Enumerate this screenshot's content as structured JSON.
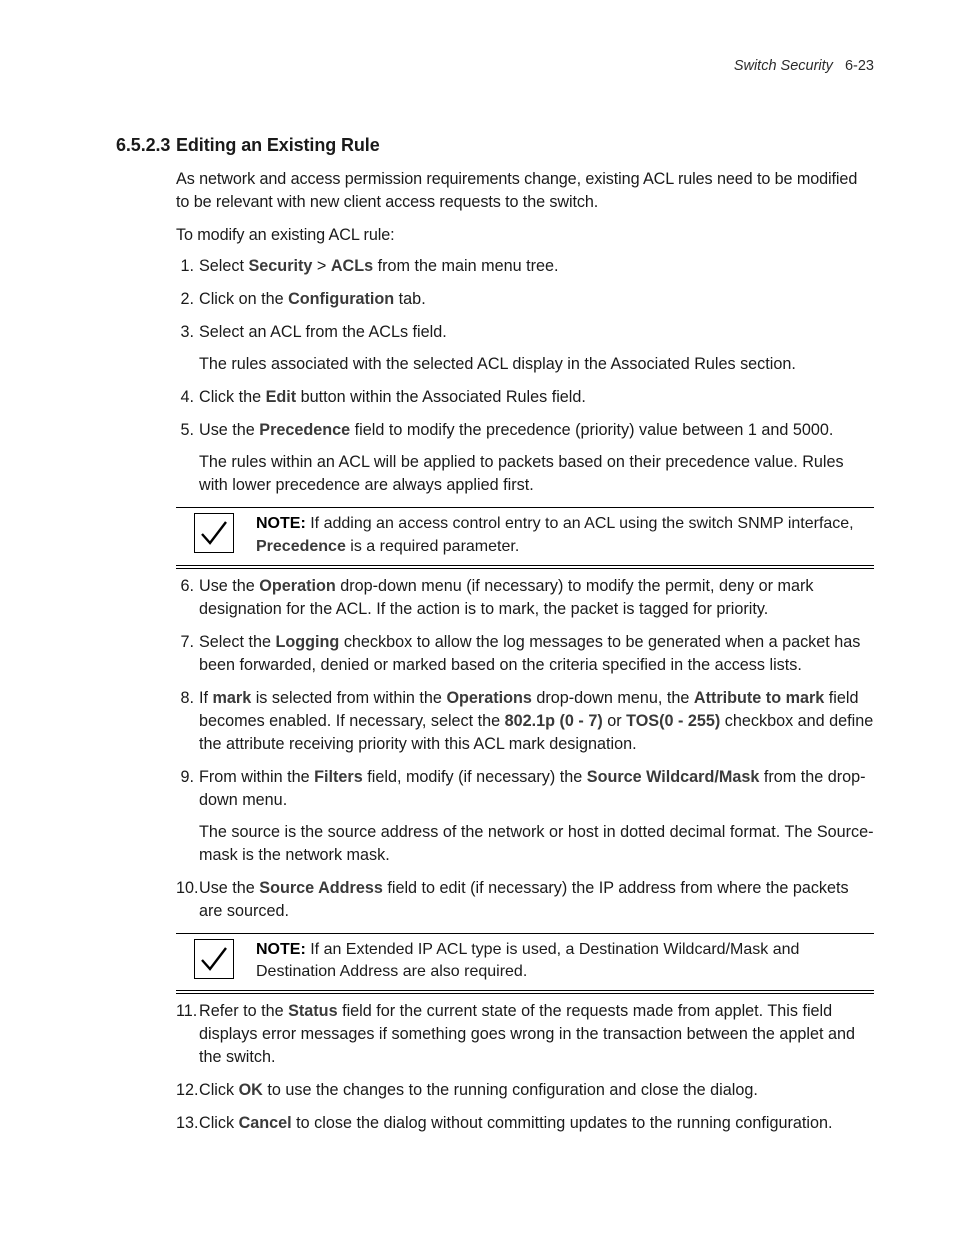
{
  "header": {
    "chapter": "Switch Security",
    "page_number": "6-23"
  },
  "section": {
    "number": "6.5.2.3",
    "title": "Editing an Existing Rule"
  },
  "intro": {
    "p1": "As network and access permission requirements change, existing ACL rules need to be modified to be relevant with new client access requests to the switch.",
    "p2": "To modify an existing ACL rule:"
  },
  "steps": [
    {
      "num": "1.",
      "parts": [
        {
          "t": "Select ",
          "b": false
        },
        {
          "t": "Security",
          "b": true
        },
        {
          "t": " > ",
          "b": false
        },
        {
          "t": "ACLs",
          "b": true
        },
        {
          "t": " from the main menu tree.",
          "b": false
        }
      ]
    },
    {
      "num": "2.",
      "parts": [
        {
          "t": "Click on the ",
          "b": false
        },
        {
          "t": "Configuration",
          "b": true
        },
        {
          "t": " tab.",
          "b": false
        }
      ]
    },
    {
      "num": "3.",
      "parts": [
        {
          "t": "Select an ACL from the ACLs field.",
          "b": false
        }
      ],
      "sub": [
        {
          "t": "The rules associated with the selected ACL display in the Associated Rules section.",
          "b": false
        }
      ]
    },
    {
      "num": "4.",
      "parts": [
        {
          "t": "Click the ",
          "b": false
        },
        {
          "t": "Edit",
          "b": true
        },
        {
          "t": " button within the Associated Rules field.",
          "b": false
        }
      ]
    },
    {
      "num": "5.",
      "parts": [
        {
          "t": "Use the ",
          "b": false
        },
        {
          "t": "Precedence",
          "b": true
        },
        {
          "t": " field to modify the precedence (priority) value between 1 and 5000.",
          "b": false
        }
      ],
      "sub": [
        {
          "t": "The rules within an ACL will be applied to packets based on their precedence value. Rules with lower precedence are always applied first.",
          "b": false
        }
      ]
    }
  ],
  "note1": {
    "label": "NOTE:",
    "parts": [
      {
        "t": " If adding an access control entry to an ACL using the switch SNMP interface, ",
        "b": false
      },
      {
        "t": "Precedence",
        "b": true
      },
      {
        "t": " is a required parameter.",
        "b": false
      }
    ]
  },
  "steps2": [
    {
      "num": "6.",
      "parts": [
        {
          "t": "Use the ",
          "b": false
        },
        {
          "t": "Operation",
          "b": true
        },
        {
          "t": " drop-down menu (if necessary) to modify the permit, deny or mark designation for the ACL. If the action is to mark, the packet is tagged for priority.",
          "b": false
        }
      ]
    },
    {
      "num": "7.",
      "parts": [
        {
          "t": "Select the ",
          "b": false
        },
        {
          "t": "Logging",
          "b": true
        },
        {
          "t": " checkbox to allow the log messages to be generated when a packet has been forwarded, denied or marked based on the criteria specified in the access lists.",
          "b": false
        }
      ]
    },
    {
      "num": "8.",
      "parts": [
        {
          "t": "If ",
          "b": false
        },
        {
          "t": "mark",
          "b": true
        },
        {
          "t": " is selected from within the ",
          "b": false
        },
        {
          "t": "Operations",
          "b": true
        },
        {
          "t": " drop-down menu, the ",
          "b": false
        },
        {
          "t": "Attribute to mark",
          "b": true
        },
        {
          "t": " field becomes enabled. If necessary, select the ",
          "b": false
        },
        {
          "t": "802.1p (0 - 7)",
          "b": true
        },
        {
          "t": " or ",
          "b": false
        },
        {
          "t": "TOS(0 - 255)",
          "b": true
        },
        {
          "t": " checkbox and define the attribute receiving priority with this ACL mark designation.",
          "b": false
        }
      ]
    },
    {
      "num": "9.",
      "parts": [
        {
          "t": "From within the ",
          "b": false
        },
        {
          "t": "Filters",
          "b": true
        },
        {
          "t": " field, modify (if necessary) the ",
          "b": false
        },
        {
          "t": "Source Wildcard/Mask",
          "b": true
        },
        {
          "t": " from the drop-down menu.",
          "b": false
        }
      ],
      "sub": [
        {
          "t": "The source is the source address of the network or host in dotted decimal format. The Source-mask is the network mask.",
          "b": false
        }
      ]
    },
    {
      "num": "10.",
      "parts": [
        {
          "t": "Use the ",
          "b": false
        },
        {
          "t": "Source Address",
          "b": true
        },
        {
          "t": " field to edit (if necessary) the IP address from where the packets are sourced.",
          "b": false
        }
      ]
    }
  ],
  "note2": {
    "label": "NOTE:",
    "parts": [
      {
        "t": " If an Extended IP ACL type is used, a Destination Wildcard/Mask and Destination Address are also required.",
        "b": false
      }
    ]
  },
  "steps3": [
    {
      "num": "11.",
      "parts": [
        {
          "t": "Refer to the ",
          "b": false
        },
        {
          "t": "Status",
          "b": true
        },
        {
          "t": " field for the current state of the requests made from applet. This field displays error messages if something goes wrong in the transaction between the applet and the switch.",
          "b": false
        }
      ]
    },
    {
      "num": "12.",
      "parts": [
        {
          "t": "Click ",
          "b": false
        },
        {
          "t": "OK",
          "b": true
        },
        {
          "t": " to use the changes to the running configuration and close the dialog.",
          "b": false
        }
      ]
    },
    {
      "num": "13.",
      "parts": [
        {
          "t": "Click ",
          "b": false
        },
        {
          "t": "Cancel",
          "b": true
        },
        {
          "t": " to close the dialog without committing updates to the running configuration.",
          "b": false
        }
      ]
    }
  ],
  "checkmark": "✓"
}
